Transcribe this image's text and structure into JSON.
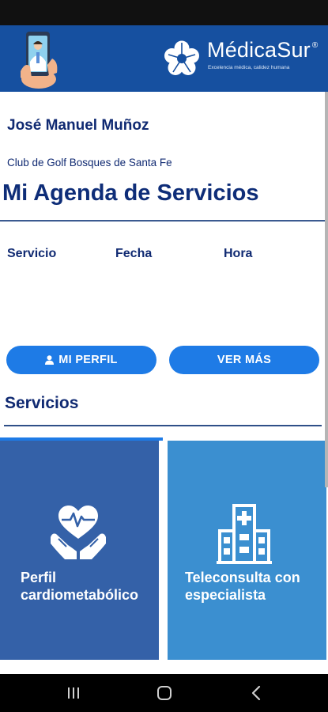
{
  "header": {
    "brand_name": "MédicaSur",
    "brand_reg": "®",
    "tagline": "Excelencia médica, calidez humana",
    "phone_illustration_icon": "doctor-on-phone-icon",
    "logo_icon": "medicasur-flower-logo-icon"
  },
  "user": {
    "name": "José Manuel Muñoz",
    "club": "Club de Golf Bosques de Santa Fe"
  },
  "agenda": {
    "title": "Mi Agenda de Servicios",
    "columns": [
      "Servicio",
      "Fecha",
      "Hora"
    ]
  },
  "actions": {
    "profile_label": "MI PERFIL",
    "profile_icon": "user-icon",
    "more_label": "VER MÁS"
  },
  "services": {
    "title": "Servicios",
    "cards": [
      {
        "label": "Perfil cardiometabólico",
        "icon": "heart-hands-icon"
      },
      {
        "label": "Teleconsulta con especialista",
        "icon": "hospital-building-icon"
      }
    ]
  },
  "nav": {
    "recents_icon": "recents-icon",
    "home_icon": "home-icon",
    "back_icon": "back-icon"
  },
  "colors": {
    "header_blue": "#1650a0",
    "title_navy": "#0e2d78",
    "button_blue": "#1e7be6",
    "card_dark_blue": "#3461a8",
    "card_light_blue": "#3b8fd0"
  }
}
